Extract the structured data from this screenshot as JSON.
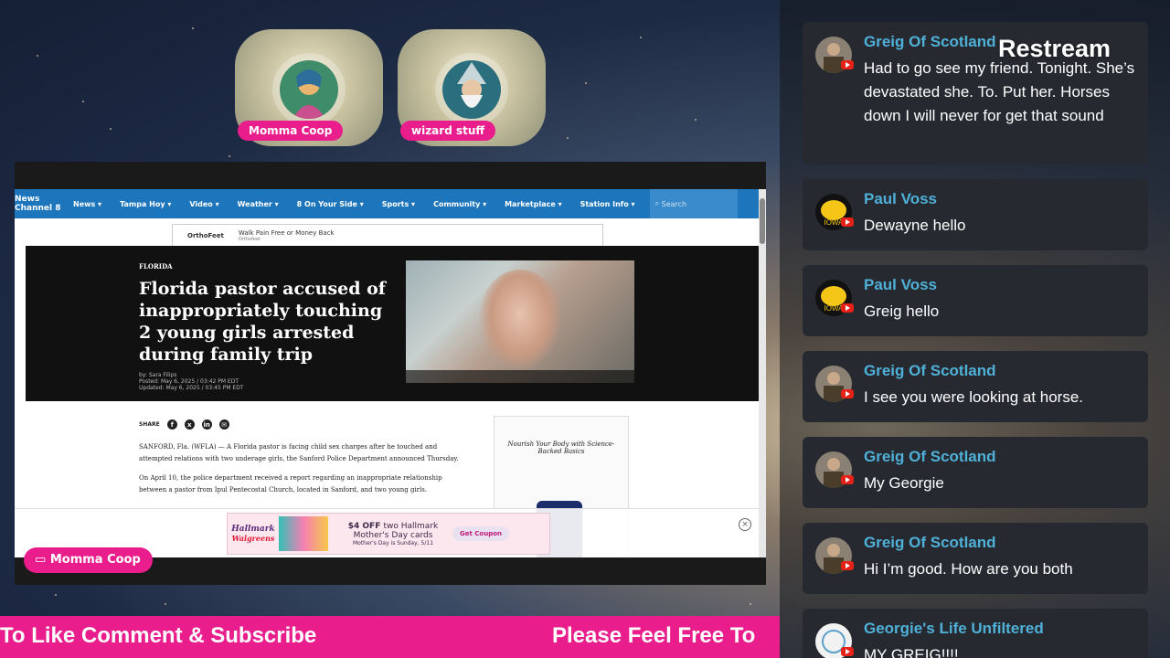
{
  "guests": [
    {
      "name": "Momma Coop"
    },
    {
      "name": "wizard stuff"
    }
  ],
  "website": {
    "logo": "News Channel 8",
    "nav": [
      "News ▾",
      "Tampa Hoy ▾",
      "Video ▾",
      "Weather ▾",
      "8 On Your Side ▾",
      "Sports ▾",
      "Community ▾",
      "Marketplace ▾",
      "Station Info ▾"
    ],
    "search_placeholder": "Search",
    "top_ad": {
      "brand": "OrthoFeet",
      "text": "Walk Pain Free or Money Back",
      "sub": "Orthofeet"
    },
    "section": "FLORIDA",
    "headline": "Florida pastor accused of inappropriately touching 2 young girls arrested during family trip",
    "byline": "by: Sara Filips",
    "posted": "Posted: May 6, 2025 / 03:42 PM EDT",
    "updated": "Updated: May 6, 2025 / 03:45 PM EDT",
    "share_label": "SHARE",
    "paragraphs": [
      "SANFORD, Fla. (WFLA) — A Florida pastor is facing child sex charges after he touched and attempted relations with two underage girls, the Sanford Police Department announced Thursday.",
      "On April 10, the police department received a report regarding an inappropriate relationship between a pastor from Ipul Pentecostal Church, located in Sanford, and two young girls."
    ],
    "side_ad": "Nourish Your Body with Science-Backed Basics",
    "bottom_ad": {
      "brand": "Hallmark",
      "sub": "Walgreens",
      "deal_bold": "$4 OFF",
      "deal": "two Hallmark Mother's Day cards",
      "note": "Mother's Day is Sunday, 5/11",
      "cta": "Get Coupon"
    }
  },
  "presenter": {
    "label": "Momma Coop"
  },
  "ticker": {
    "left_text": "To Like Comment & Subscribe",
    "right_text": "Please Feel Free To"
  },
  "watermark": "Restream",
  "chat": [
    {
      "author": "Greig Of Scotland",
      "text": "Had to go see my friend. Tonight. She’s devastated she. To. Put her. Horses down I will never for get that sound",
      "avatar": "greig"
    },
    {
      "author": "Paul Voss",
      "text": "Dewayne hello",
      "avatar": "iowa"
    },
    {
      "author": "Paul Voss",
      "text": "Greig hello",
      "avatar": "iowa"
    },
    {
      "author": "Greig Of Scotland",
      "text": "I see you were looking at horse.",
      "avatar": "greig"
    },
    {
      "author": "Greig Of Scotland",
      "text": "My Georgie",
      "avatar": "greig"
    },
    {
      "author": "Greig Of Scotland",
      "text": "Hi I’m good. How are you both",
      "avatar": "greig"
    },
    {
      "author": "Georgie's Life Unfiltered",
      "text": "MY GREIG!!!!",
      "avatar": "georgie"
    }
  ],
  "colors": {
    "accent": "#e91e8c",
    "chat_author": "#4fb0d8",
    "youtube": "#e62117"
  }
}
